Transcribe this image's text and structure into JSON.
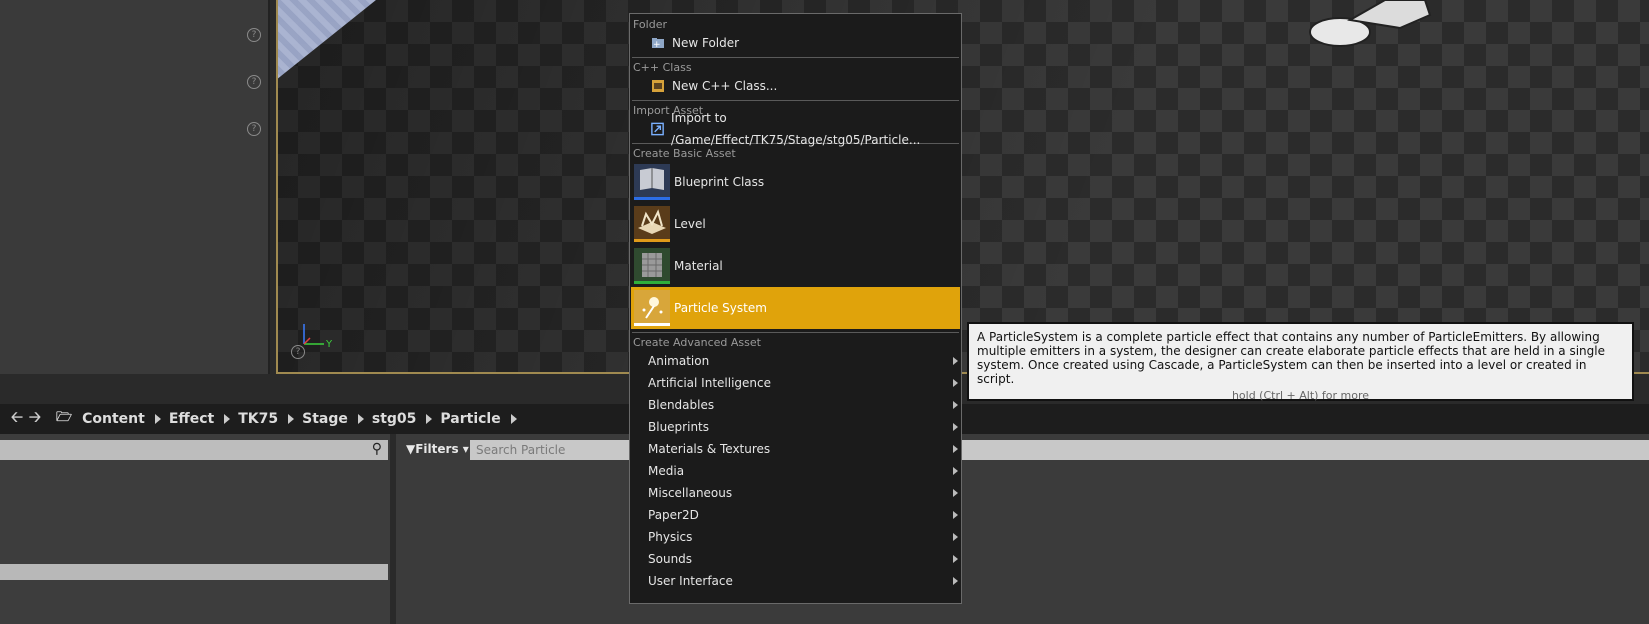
{
  "breadcrumb": {
    "items": [
      "Content",
      "Effect",
      "TK75",
      "Stage",
      "stg05",
      "Particle"
    ]
  },
  "content_browser": {
    "filters_label": "Filters",
    "search_placeholder": "Search Particle"
  },
  "viewport": {
    "axis_y_label": "Y"
  },
  "context_menu": {
    "folder_section": "Folder",
    "new_folder": "New Folder",
    "cpp_section": "C++ Class",
    "new_cpp_class": "New C++ Class...",
    "import_section": "Import Asset",
    "import_to": "Import to /Game/Effect/TK75/Stage/stg05/Particle...",
    "basic_section": "Create Basic Asset",
    "basic_assets": [
      {
        "label": "Blueprint Class",
        "stripe": "#2c6ee8"
      },
      {
        "label": "Level",
        "stripe": "#e09a1a"
      },
      {
        "label": "Material",
        "stripe": "#2fae3b"
      },
      {
        "label": "Particle System",
        "stripe": "#ffffff"
      }
    ],
    "advanced_section": "Create Advanced Asset",
    "advanced_items": [
      "Animation",
      "Artificial Intelligence",
      "Blendables",
      "Blueprints",
      "Materials & Textures",
      "Media",
      "Miscellaneous",
      "Paper2D",
      "Physics",
      "Sounds",
      "User Interface"
    ]
  },
  "tooltip": {
    "text": "A ParticleSystem is a complete particle effect that contains any number of ParticleEmitters. By allowing multiple emitters in a system, the designer can create elaborate particle effects that are held in a single system. Once created using Cascade, a ParticleSystem can then be inserted into a level or created in script.",
    "hint": "hold (Ctrl + Alt) for more"
  },
  "colors": {
    "selection_accent": "#e0a30b",
    "menu_bg": "#1b1b1b"
  }
}
